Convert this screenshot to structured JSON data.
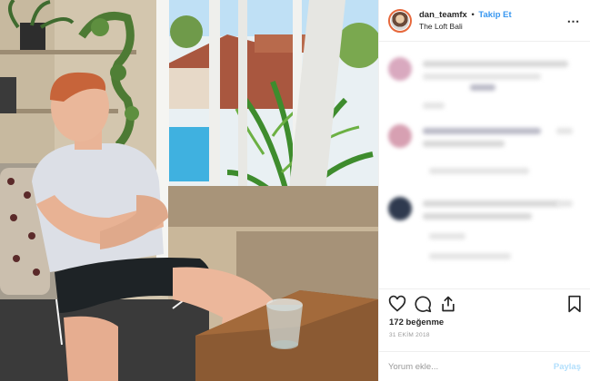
{
  "post": {
    "username": "dan_teamfx",
    "separator": "•",
    "follow_label": "Takip Et",
    "location": "The Loft Bali",
    "more_icon": "more-options-icon",
    "likes_text": "172 beğenme",
    "date_text": "31 EKİM 2018",
    "comment_placeholder": "Yorum ekle...",
    "post_label": "Paylaş"
  },
  "icons": {
    "like": "heart-icon",
    "comment": "comment-bubble-icon",
    "share": "share-icon",
    "save": "bookmark-icon"
  },
  "colors": {
    "follow": "#3897f0",
    "post_disabled": "#b2dffc",
    "avatar_ring": "#e6683c",
    "border": "#efefef"
  }
}
